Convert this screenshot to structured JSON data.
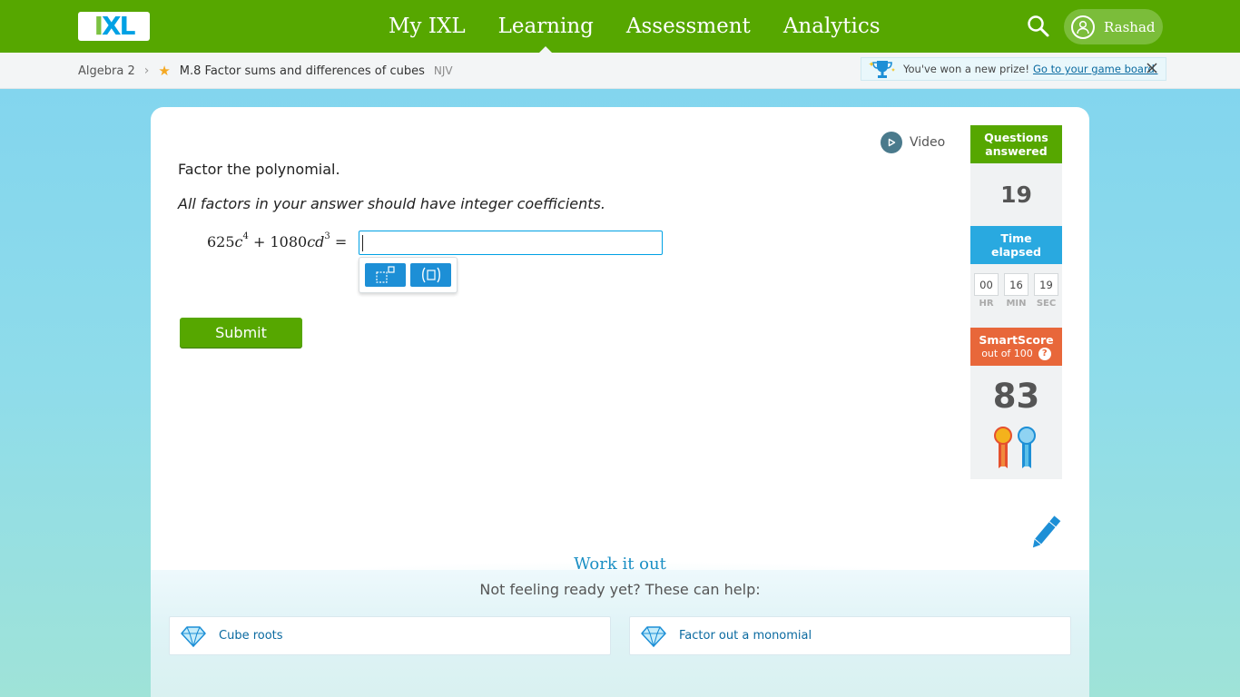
{
  "header": {
    "logo_text": "IXL",
    "nav": [
      {
        "label": "My IXL",
        "active": false
      },
      {
        "label": "Learning",
        "active": true
      },
      {
        "label": "Assessment",
        "active": false
      },
      {
        "label": "Analytics",
        "active": false
      }
    ],
    "user_name": "Rashad",
    "colors": {
      "brand_green": "#56a700",
      "logo_blue": "#00a1e4"
    }
  },
  "breadcrumb": {
    "subject": "Algebra 2",
    "skill": "M.8 Factor sums and differences of cubes",
    "code": "NJV"
  },
  "prize_banner": {
    "text": "You've won a new prize!",
    "link": "Go to your game board."
  },
  "question": {
    "video_label": "Video",
    "prompt": "Factor the polynomial.",
    "note": "All factors in your answer should have integer coefficients.",
    "expression": {
      "coef1": "625",
      "var1": "c",
      "exp1": "4",
      "op": "+",
      "coef2": "1080",
      "var2": "cd",
      "exp2": "3",
      "equals": "="
    },
    "answer_value": "",
    "tools": [
      "exponent-icon",
      "parentheses-icon"
    ],
    "submit_label": "Submit"
  },
  "sidebar": {
    "questions_answered_label": "Questions answered",
    "questions_answered_line1": "Questions",
    "questions_answered_line2": "answered",
    "questions_answered": "19",
    "time_elapsed_line1": "Time",
    "time_elapsed_line2": "elapsed",
    "time": {
      "hr": "00",
      "min": "16",
      "sec": "19"
    },
    "time_labels": {
      "hr": "HR",
      "min": "MIN",
      "sec": "SEC"
    },
    "smartscore_label": "SmartScore",
    "smartscore_sub": "out of 100",
    "smartscore_help": "?",
    "smartscore": "83"
  },
  "work_it_out": {
    "title": "Work it out",
    "subtitle": "Not feeling ready yet? These can help:",
    "links": [
      {
        "label": "Cube roots",
        "icon": "diamond-icon"
      },
      {
        "label": "Factor out a monomial",
        "icon": "diamond-icon"
      }
    ]
  }
}
